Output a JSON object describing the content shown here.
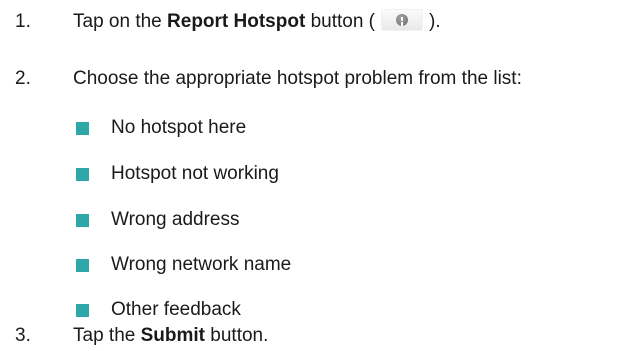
{
  "steps": [
    {
      "number": "1.",
      "prefix": "Tap on the ",
      "bold": "Report Hotspot",
      "middle": " button (",
      "suffix": ")."
    },
    {
      "number": "2.",
      "text": "Choose the appropriate hotspot problem from the list:"
    },
    {
      "number": "3.",
      "prefix": "Tap the ",
      "bold": "Submit",
      "suffix": " button."
    }
  ],
  "options": [
    "No hotspot here",
    "Hotspot not working",
    "Wrong address",
    "Wrong network name",
    "Other feedback"
  ],
  "colors": {
    "bullet": "#2ea7a8",
    "text": "#1a1a1a"
  },
  "icons": {
    "report_hotspot_button": "report-hotspot-icon"
  }
}
